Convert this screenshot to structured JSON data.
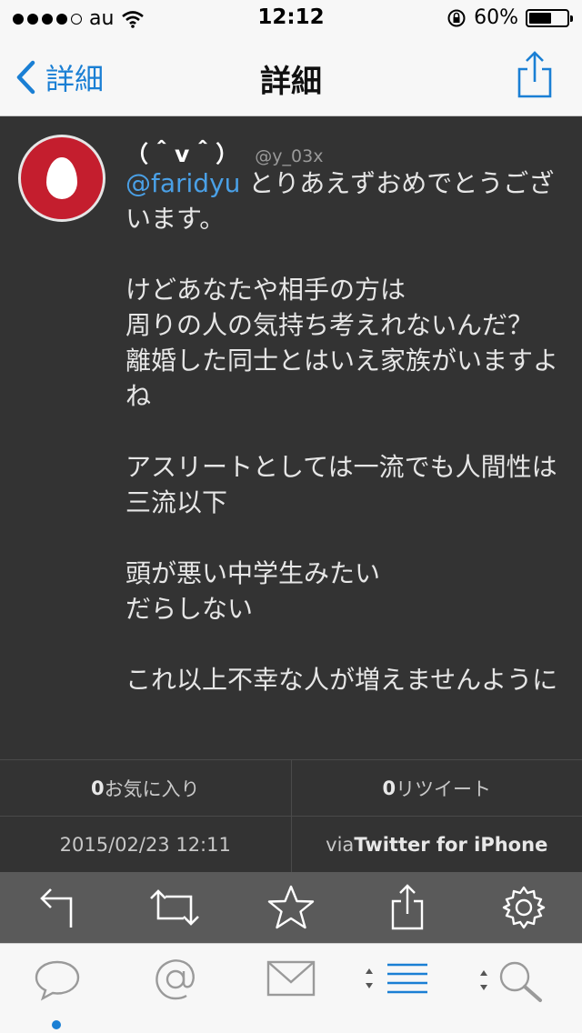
{
  "status": {
    "carrier": "au",
    "time": "12:12",
    "battery_percent": "60%",
    "battery_level": 0.6
  },
  "nav": {
    "back_label": "詳細",
    "title": "詳細"
  },
  "tweet": {
    "display_name": "（＾v＾）",
    "handle": "@y_03x",
    "mention": "@faridyu",
    "text": " とりあえずおめでとうございます。\n\nけどあなたや相手の方は\n周りの人の気持ち考えれないんだ？\n離婚した同士とはいえ家族がいますよね\n\nアスリートとしては一流でも人間性は三流以下\n\n頭が悪い中学生みたい\nだらしない\n\nこれ以上不幸な人が増えませんように",
    "favorites_count": "0",
    "favorites_label": " お気に入り",
    "retweets_count": "0",
    "retweets_label": "リツイート",
    "timestamp": "2015/02/23 12:11",
    "via_prefix": "via ",
    "via_client": "Twitter for iPhone"
  },
  "actions": [
    "reply-icon",
    "retweet-icon",
    "favorite-icon",
    "share-icon",
    "settings-icon"
  ],
  "tabs": [
    "timeline-bubble-icon",
    "mentions-at-icon",
    "messages-envelope-icon",
    "lists-icon",
    "search-icon"
  ],
  "colors": {
    "accent": "#1a7fd4",
    "mention": "#4aa0e6",
    "background": "#333333",
    "avatar_red": "#c41e2e"
  }
}
